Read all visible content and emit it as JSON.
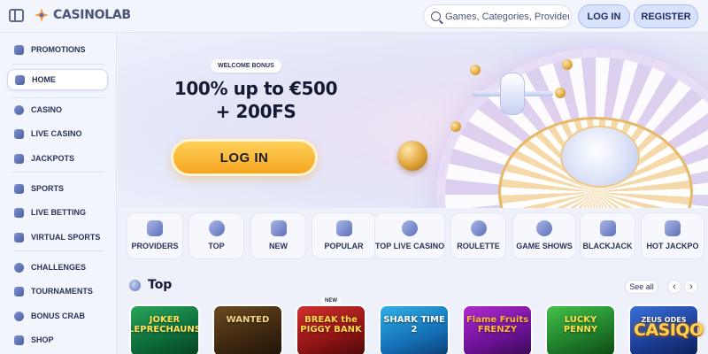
{
  "header": {
    "logo_text": "CASINOLAB",
    "search_placeholder": "Games, Categories, Providers",
    "login_label": "LOG IN",
    "register_label": "REGISTER"
  },
  "sidebar": {
    "items": [
      {
        "label": "PROMOTIONS",
        "icon": "promo-icon"
      },
      {
        "label": "HOME",
        "icon": "home-icon",
        "active": true
      },
      {
        "label": "CASINO",
        "icon": "casino-icon"
      },
      {
        "label": "LIVE CASINO",
        "icon": "live-casino-icon"
      },
      {
        "label": "JACKPOTS",
        "icon": "jackpot-icon"
      },
      {
        "label": "SPORTS",
        "icon": "sports-icon"
      },
      {
        "label": "LIVE BETTING",
        "icon": "live-betting-icon"
      },
      {
        "label": "VIRTUAL SPORTS",
        "icon": "virtual-sports-icon"
      },
      {
        "label": "CHALLENGES",
        "icon": "challenges-icon"
      },
      {
        "label": "TOURNAMENTS",
        "icon": "trophy-icon"
      },
      {
        "label": "BONUS CRAB",
        "icon": "bonus-crab-icon"
      },
      {
        "label": "SHOP",
        "icon": "shop-icon"
      }
    ]
  },
  "hero": {
    "badge": "WELCOME BONUS",
    "title_line1": "100% up to €500",
    "title_line2": "+ 200FS",
    "cta_label": "LOG IN"
  },
  "categories": [
    {
      "label": "PROVIDERS",
      "icon": "filter-icon"
    },
    {
      "label": "TOP",
      "icon": "badge-icon"
    },
    {
      "label": "NEW",
      "icon": "new-icon"
    },
    {
      "label": "POPULAR",
      "icon": "star-icon"
    },
    {
      "label": "TOP LIVE CASINO",
      "icon": "live-icon"
    },
    {
      "label": "ROULETTE",
      "icon": "roulette-icon"
    },
    {
      "label": "GAME SHOWS",
      "icon": "game-shows-icon"
    },
    {
      "label": "BLACKJACK",
      "icon": "cards-icon"
    },
    {
      "label": "HOT JACKPO",
      "icon": "hot-jackpot-icon"
    }
  ],
  "top_section": {
    "title": "Top",
    "see_all": "See all",
    "prev_arrow": "‹",
    "next_arrow": "›"
  },
  "games": [
    {
      "title": "JOKER LEPRECHAUNS",
      "badge": ""
    },
    {
      "title": "WANTED",
      "badge": ""
    },
    {
      "title": "BREAK the PIGGY BANK",
      "badge": "NEW"
    },
    {
      "title": "SHARK TIME 2",
      "badge": ""
    },
    {
      "title": "Flame Fruits FRENZY",
      "badge": ""
    },
    {
      "title": "LUCKY PENNY",
      "badge": ""
    },
    {
      "title": "ZEUS ODES",
      "badge": ""
    }
  ],
  "overlay_brand": "CASIQO"
}
